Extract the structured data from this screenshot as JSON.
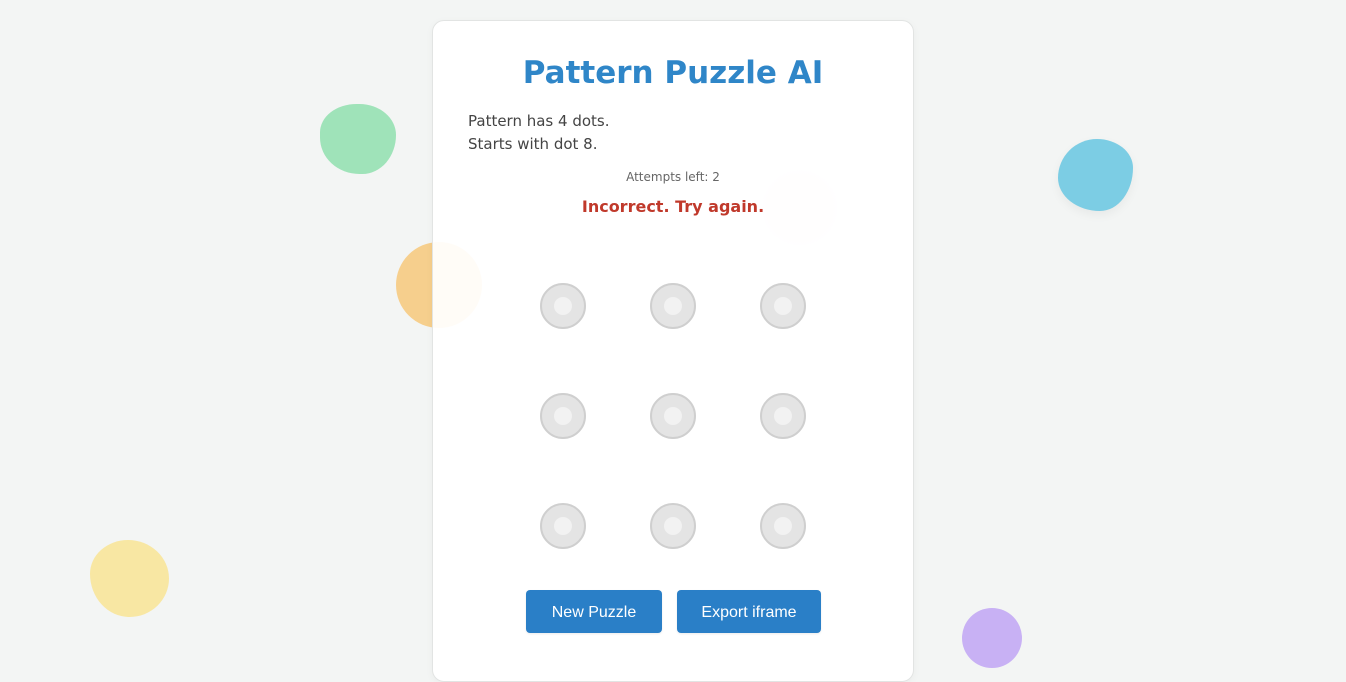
{
  "app": {
    "title": "Pattern Puzzle AI"
  },
  "puzzle": {
    "hint_count": "Pattern has 4 dots.",
    "hint_start": "Starts with dot 8.",
    "attempts": "Attempts left: 2",
    "message": "Incorrect. Try again."
  },
  "grid": {
    "dots": [
      1,
      2,
      3,
      4,
      5,
      6,
      7,
      8,
      9
    ]
  },
  "buttons": {
    "new_puzzle": "New Puzzle",
    "export_iframe": "Export iframe"
  },
  "colors": {
    "accent": "#2f86c8",
    "button": "#2a7fc7",
    "error": "#c0392b"
  }
}
